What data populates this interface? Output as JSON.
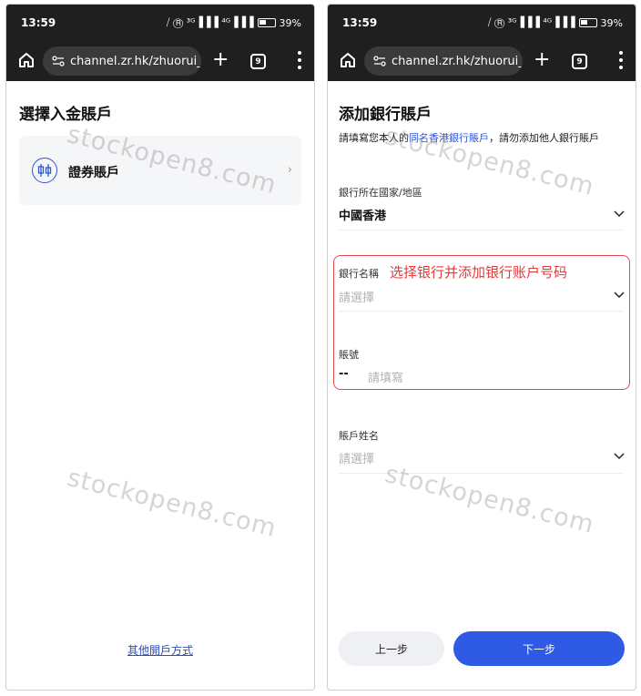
{
  "status": {
    "time": "13:59",
    "indicators": "⧸ Ⓡ ³ᴳ▐▐▐ ⁴ᴳ▐▐▐",
    "battery_pct": "39%"
  },
  "browser": {
    "url": "channel.zr.hk/zhuorui_\\",
    "tab_count": "9"
  },
  "left_screen": {
    "title": "選擇入金賬戶",
    "account_option": "證券賬戶",
    "other_method_link": "其他開戶方式"
  },
  "right_screen": {
    "title": "添加銀行賬戶",
    "note": {
      "prefix": "請填寫您本人的",
      "highlight": "同名香港銀行賬戶",
      "suffix": "，請勿添加他人銀行賬戶"
    },
    "country": {
      "label": "銀行所在國家/地區",
      "value": "中國香港"
    },
    "bank_name": {
      "label": "銀行名稱",
      "placeholder": "請選擇"
    },
    "account_number": {
      "label": "賬號",
      "prefix": "--",
      "placeholder": "請填寫"
    },
    "account_name": {
      "label": "賬戶姓名",
      "placeholder": "請選擇"
    },
    "annotation": "选择银行并添加银行账户号码",
    "buttons": {
      "prev": "上一步",
      "next": "下一步"
    }
  },
  "watermark": "stockopen8.com",
  "colors": {
    "accent": "#2f5ae3",
    "annotation_red": "#e23b3b",
    "chrome": "#1f1f1f"
  }
}
